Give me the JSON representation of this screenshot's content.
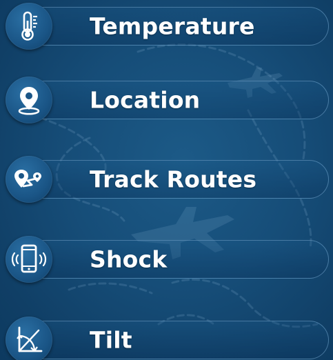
{
  "menu": {
    "items": [
      {
        "label": "Temperature",
        "icon": "thermometer-icon"
      },
      {
        "label": "Location",
        "icon": "location-pin-icon"
      },
      {
        "label": "Track Routes",
        "icon": "route-icon"
      },
      {
        "label": "Shock",
        "icon": "vibrating-phone-icon"
      },
      {
        "label": "Tilt",
        "icon": "tilt-angle-icon"
      }
    ]
  },
  "colors": {
    "background": "#164d78",
    "icon_circle": "#1a5586",
    "text": "#ffffff",
    "pill_border": "#8cbee6"
  }
}
